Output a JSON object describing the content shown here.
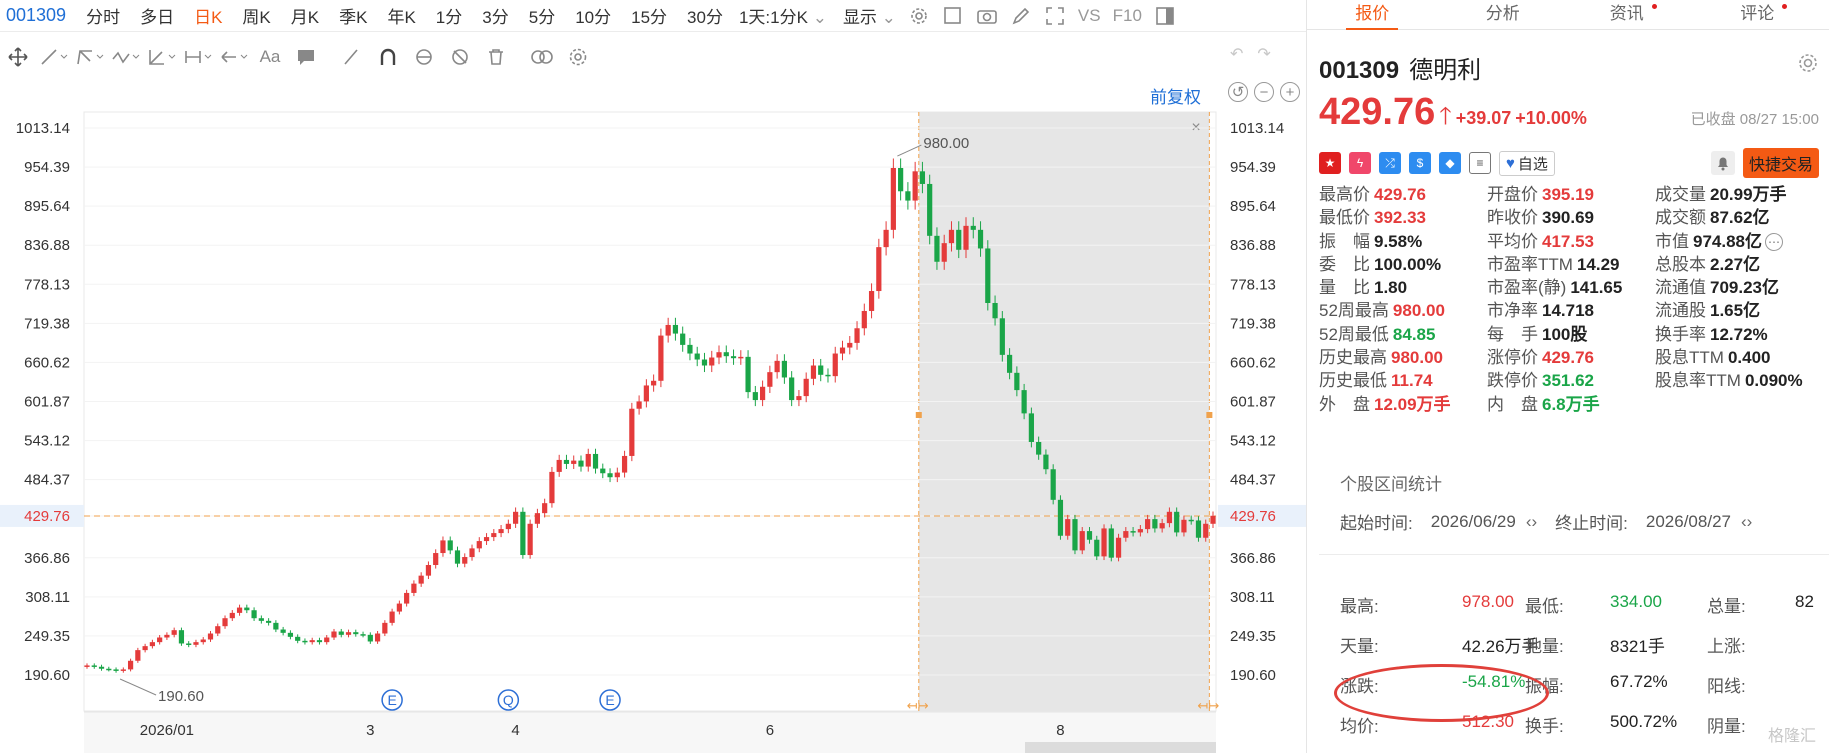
{
  "toolbar_top": {
    "symbol": "001309",
    "timeframes": [
      "分时",
      "多日",
      "日K",
      "周K",
      "月K",
      "季K",
      "年K",
      "1分",
      "3分",
      "5分",
      "10分",
      "15分",
      "30分"
    ],
    "active_timeframe": "日K",
    "multi_view": "1天:1分K",
    "display": "显示",
    "vs": "VS",
    "f10": "F10"
  },
  "chart_header": {
    "adjust_label": "前复权"
  },
  "colors": {
    "up": "#e43b3b",
    "down": "#1aa548",
    "accent": "#f45a14",
    "link": "#1f6fd6",
    "ref_line": "#f0a24c",
    "selection": "#e6e6e6"
  },
  "chart_data": {
    "type": "candlestick",
    "y_ticks": [
      "1013.14",
      "954.39",
      "895.64",
      "836.88",
      "778.13",
      "719.38",
      "660.62",
      "601.87",
      "543.12",
      "484.37",
      "429.76",
      "366.86",
      "308.11",
      "249.35",
      "190.60"
    ],
    "ylim": [
      190.6,
      1013.14
    ],
    "x_labels": [
      {
        "label": "2026/01",
        "index": 11
      },
      {
        "label": "3",
        "index": 39
      },
      {
        "label": "4",
        "index": 59
      },
      {
        "label": "6",
        "index": 94
      },
      {
        "label": "8",
        "index": 134
      }
    ],
    "current_price": "429.76",
    "high_annotation": "980.00",
    "low_annotation": "190.60",
    "event_markers": [
      "E",
      "Q",
      "E"
    ],
    "selection_range": {
      "start_index": 115,
      "end_index": 154
    },
    "closes": [
      205,
      203,
      200,
      199,
      197,
      199,
      212,
      228,
      234,
      240,
      247,
      251,
      258,
      238,
      236,
      240,
      244,
      253,
      264,
      276,
      284,
      292,
      288,
      276,
      272,
      269,
      259,
      254,
      248,
      242,
      240,
      243,
      240,
      247,
      256,
      251,
      255,
      252,
      251,
      241,
      253,
      269,
      286,
      298,
      314,
      328,
      340,
      356,
      374,
      393,
      378,
      358,
      368,
      381,
      392,
      398,
      404,
      410,
      418,
      436,
      371,
      418,
      434,
      449,
      496,
      514,
      508,
      513,
      504,
      523,
      501,
      494,
      488,
      495,
      520,
      591,
      602,
      626,
      633,
      701,
      717,
      704,
      687,
      674,
      665,
      656,
      668,
      676,
      670,
      667,
      669,
      616,
      604,
      624,
      646,
      663,
      638,
      604,
      610,
      636,
      656,
      642,
      640,
      674,
      683,
      690,
      712,
      738,
      768,
      834,
      860,
      953,
      918,
      904,
      948,
      929,
      851,
      812,
      840,
      860,
      830,
      866,
      860,
      832,
      750,
      727,
      672,
      645,
      619,
      584,
      541,
      522,
      500,
      454,
      400,
      425,
      378,
      407,
      394,
      369,
      411,
      367,
      397,
      407,
      405,
      410,
      425,
      411,
      419,
      436,
      405,
      424,
      423,
      397,
      418,
      430
    ],
    "last_close": "429.76"
  },
  "quote": {
    "code": "001309",
    "name": "德明利",
    "price": "429.76",
    "change": "+39.07",
    "change_pct": "+10.00%",
    "status": "已收盘 08/27 15:00",
    "watchlist_label": "自选",
    "trade_label": "快捷交易"
  },
  "stats": [
    [
      {
        "l": "最高价",
        "v": "429.76",
        "c": "red"
      },
      {
        "l": "开盘价",
        "v": "395.19",
        "c": "red"
      },
      {
        "l": "成交量",
        "v": "20.99万手",
        "c": "dark"
      }
    ],
    [
      {
        "l": "最低价",
        "v": "392.33",
        "c": "red"
      },
      {
        "l": "昨收价",
        "v": "390.69",
        "c": "dark"
      },
      {
        "l": "成交额",
        "v": "87.62亿",
        "c": "dark"
      }
    ],
    [
      {
        "l": "振　幅",
        "v": "9.58%",
        "c": "dark"
      },
      {
        "l": "平均价",
        "v": "417.53",
        "c": "red"
      },
      {
        "l": "市值",
        "v": "974.88亿",
        "c": "dark",
        "more": true
      }
    ],
    [
      {
        "l": "委　比",
        "v": "100.00%",
        "c": "dark"
      },
      {
        "l": "市盈率TTM",
        "v": "14.29",
        "c": "dark"
      },
      {
        "l": "总股本",
        "v": "2.27亿",
        "c": "dark"
      }
    ],
    [
      {
        "l": "量　比",
        "v": "1.80",
        "c": "dark"
      },
      {
        "l": "市盈率(静)",
        "v": "141.65",
        "c": "dark"
      },
      {
        "l": "流通值",
        "v": "709.23亿",
        "c": "dark"
      }
    ],
    [
      {
        "l": "52周最高",
        "v": "980.00",
        "c": "red"
      },
      {
        "l": "市净率",
        "v": "14.718",
        "c": "dark"
      },
      {
        "l": "流通股",
        "v": "1.65亿",
        "c": "dark"
      }
    ],
    [
      {
        "l": "52周最低",
        "v": "84.85",
        "c": "green"
      },
      {
        "l": "每　手",
        "v": "100股",
        "c": "dark"
      },
      {
        "l": "换手率",
        "v": "12.72%",
        "c": "dark"
      }
    ],
    [
      {
        "l": "历史最高",
        "v": "980.00",
        "c": "red"
      },
      {
        "l": "涨停价",
        "v": "429.76",
        "c": "red"
      },
      {
        "l": "股息TTM",
        "v": "0.400",
        "c": "dark"
      }
    ],
    [
      {
        "l": "历史最低",
        "v": "11.74",
        "c": "red"
      },
      {
        "l": "跌停价",
        "v": "351.62",
        "c": "green"
      },
      {
        "l": "股息率TTM",
        "v": "0.090%",
        "c": "dark"
      }
    ],
    [
      {
        "l": "外　盘",
        "v": "12.09万手",
        "c": "red"
      },
      {
        "l": "内　盘",
        "v": "6.8万手",
        "c": "green"
      },
      {
        "l": "",
        "v": "",
        "c": "dark"
      }
    ]
  ],
  "range": {
    "title": "个股区间统计",
    "start_label": "起始时间:",
    "start": "2026/06/29",
    "end_label": "终止时间:",
    "end": "2026/08/27",
    "rows": [
      [
        {
          "l": "最高:",
          "v": "978.00",
          "c": "red"
        },
        {
          "l": "最低:",
          "v": "334.00",
          "c": "green"
        },
        {
          "l": "总量:",
          "v": "82",
          "c": "dark"
        }
      ],
      [
        {
          "l": "天量:",
          "v": "42.26万手",
          "c": "dark"
        },
        {
          "l": "地量:",
          "v": "8321手",
          "c": "dark"
        },
        {
          "l": "上涨:",
          "v": "",
          "c": "dark"
        }
      ],
      [
        {
          "l": "涨跌:",
          "v": "-54.81%",
          "c": "green"
        },
        {
          "l": "振幅:",
          "v": "67.72%",
          "c": "dark"
        },
        {
          "l": "阳线:",
          "v": "",
          "c": "dark"
        }
      ],
      [
        {
          "l": "均价:",
          "v": "512.30",
          "c": "red"
        },
        {
          "l": "换手:",
          "v": "500.72%",
          "c": "dark"
        },
        {
          "l": "阴量:",
          "v": "",
          "c": "dark"
        }
      ]
    ]
  },
  "right_tabs": [
    {
      "label": "报价",
      "active": true,
      "dot": false
    },
    {
      "label": "分析",
      "active": false,
      "dot": false
    },
    {
      "label": "资讯",
      "active": false,
      "dot": true
    },
    {
      "label": "评论",
      "active": false,
      "dot": true
    }
  ],
  "watermark": "格隆汇"
}
